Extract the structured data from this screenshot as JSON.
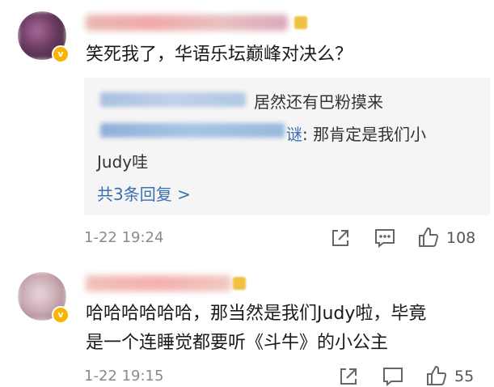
{
  "comments": [
    {
      "text": "笑死我了，华语乐坛巅峰对决么？",
      "replies": [
        {
          "text": "居然还有巴粉摸来"
        },
        {
          "text_line1": ": 那肯定是我们小",
          "text_line2": "Judy哇",
          "visible_name_tail": "谜"
        }
      ],
      "more_replies_label": "共3条回复 >",
      "timestamp": "1-22 19:24",
      "likes": "108"
    },
    {
      "text_line1": "哈哈哈哈哈哈，那当然是我们Judy啦，毕竟",
      "text_line2": "是一个连睡觉都要听《斗牛》的小公主",
      "timestamp": "1-22 19:15",
      "likes": "55"
    }
  ],
  "icons": {
    "share": "share-icon",
    "comment": "comment-icon",
    "like": "thumbs-up-icon"
  }
}
